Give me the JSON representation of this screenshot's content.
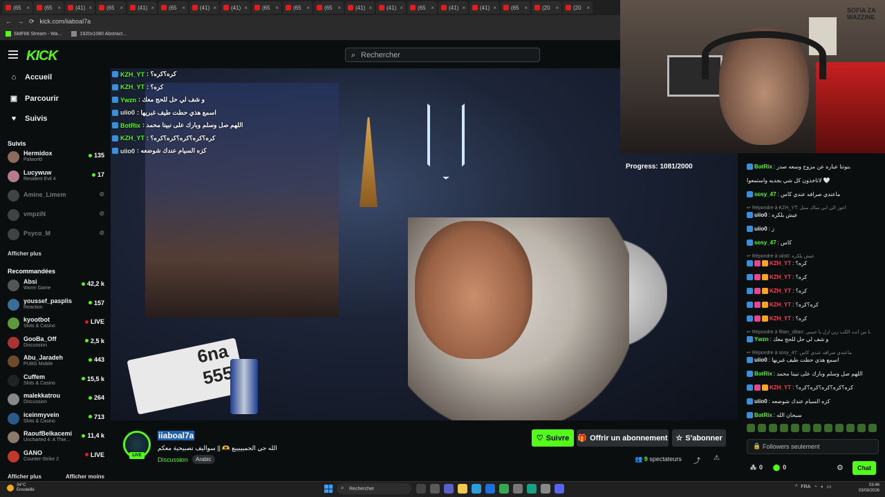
{
  "browser": {
    "tabs": [
      {
        "label": "(65"
      },
      {
        "label": "(65"
      },
      {
        "label": "(41)"
      },
      {
        "label": "(65"
      },
      {
        "label": "(41)"
      },
      {
        "label": "(65"
      },
      {
        "label": "(41)"
      },
      {
        "label": "(41)"
      },
      {
        "label": "(65"
      },
      {
        "label": "(65"
      },
      {
        "label": "(65"
      },
      {
        "label": "(41)"
      },
      {
        "label": "(41)"
      },
      {
        "label": "(65"
      },
      {
        "label": "(41)"
      },
      {
        "label": "(41)"
      },
      {
        "label": "(65"
      },
      {
        "label": "(20"
      },
      {
        "label": "(20"
      }
    ],
    "url": "kick.com/iiaboal7a",
    "bookmarks": [
      "SMF86 Stream - Wa...",
      "1920x1080 Abstract..."
    ]
  },
  "header": {
    "logo": "KICK",
    "search_placeholder": "Rechercher"
  },
  "sidebar": {
    "nav": [
      {
        "label": "Accueil",
        "icon": "home-icon"
      },
      {
        "label": "Parcourir",
        "icon": "browse-icon"
      },
      {
        "label": "Suivis",
        "icon": "heart-icon"
      }
    ],
    "following_title": "Suivis",
    "following": [
      {
        "name": "Hermidox",
        "game": "Palworld",
        "viewers": "135",
        "live": true
      },
      {
        "name": "Lucywuw",
        "game": "Resident Evil 4",
        "viewers": "17",
        "live": true
      },
      {
        "name": "Amine_Limem",
        "game": "",
        "viewers": "",
        "live": false
      },
      {
        "name": "vmpziN",
        "game": "",
        "viewers": "",
        "live": false
      },
      {
        "name": "Psyco_M",
        "game": "",
        "viewers": "",
        "live": false
      }
    ],
    "show_more": "Afficher plus",
    "recommended_title": "Recommandées",
    "recommended": [
      {
        "name": "Absi",
        "game": "Worm Game",
        "viewers": "42,2 k"
      },
      {
        "name": "youssef_pasplis",
        "game": "Reaction",
        "viewers": "157"
      },
      {
        "name": "kyootbot",
        "game": "Slots & Casino",
        "viewers": "LIVE"
      },
      {
        "name": "GooBa_Off",
        "game": "Discussion",
        "viewers": "2,5 k"
      },
      {
        "name": "Abu_Jaradeh",
        "game": "PUBG Mobile",
        "viewers": "443"
      },
      {
        "name": "Cuffem",
        "game": "Slots & Casino",
        "viewers": "15,5 k"
      },
      {
        "name": "malekkatrou",
        "game": "Discussion",
        "viewers": "264"
      },
      {
        "name": "iceinmyvein",
        "game": "Slots & Casino",
        "viewers": "713"
      },
      {
        "name": "RaoufBelkacemi",
        "game": "Uncharted 4: A Thie...",
        "viewers": "11,4 k"
      },
      {
        "name": "GANO",
        "game": "Counter-Strike 2",
        "viewers": "LIVE"
      }
    ],
    "show_more_bottom": "Afficher plus",
    "show_less": "Afficher moins"
  },
  "overlay_chat": [
    {
      "user": "KZH_YT",
      "color": "#53fc18",
      "msg": ": كره؟كره؟"
    },
    {
      "user": "KZH_YT",
      "color": "#53fc18",
      "msg": ": كره؟"
    },
    {
      "user": "Ywzn",
      "color": "#53fc18",
      "msg": ": و شف لي حل للحج معك"
    },
    {
      "user": "uiio0",
      "color": "#e8e8e8",
      "msg": ": اسمع هذي حطت طيف غبريها"
    },
    {
      "user": "BotRix",
      "color": "#53fc18",
      "msg": ": اللهم صل وسلم وبارك على نبينا محمد"
    },
    {
      "user": "KZH_YT",
      "color": "#53fc18",
      "msg": ": كره؟كره؟كره؟كره؟كره؟"
    },
    {
      "user": "uiio0",
      "color": "#e8e8e8",
      "msg": ": كزه السيام عندك شوضعه"
    }
  ],
  "webcam": {
    "progress": "Progress: 1081/2000",
    "wall_text": "SOFIA ZA WAZZINE"
  },
  "chat": {
    "messages": [
      {
        "type": "msg",
        "user": "BotRix",
        "color": "#53fc18",
        "text": ": بنوتنا عباره عن مزوح وسعه صدر"
      },
      {
        "type": "text",
        "text": "لاتاخذون كل شي بجديه واستمعوا 🤍"
      },
      {
        "type": "msg",
        "user": "sosy_47",
        "color": "#53fc18",
        "text": ": ماعندي صرافه عندي كاس"
      },
      {
        "type": "reply",
        "text": "Répondre à KZH_YT: اعور الي ابي ساك ستل"
      },
      {
        "type": "msg",
        "user": "uiio0",
        "color": "#e8e8e8",
        "text": ": عيش يلكره"
      },
      {
        "type": "msg",
        "user": "uiio0",
        "color": "#e8e8e8",
        "text": ": ز"
      },
      {
        "type": "msg",
        "user": "sosy_47",
        "color": "#53fc18",
        "text": ": كاس"
      },
      {
        "type": "reply",
        "text": "Répondre à uiio0: عيش يلكره"
      },
      {
        "type": "msg",
        "user": "KZH_YT",
        "color": "#ff3b5c",
        "text": ": كره؟"
      },
      {
        "type": "msg",
        "user": "KZH_YT",
        "color": "#ff3b5c",
        "text": ": كره؟"
      },
      {
        "type": "msg",
        "user": "KZH_YT",
        "color": "#ff3b5c",
        "text": ": كره؟"
      },
      {
        "type": "msg",
        "user": "KZH_YT",
        "color": "#ff3b5c",
        "text": ": كره؟كره؟"
      },
      {
        "type": "msg",
        "user": "KZH_YT",
        "color": "#ff3b5c",
        "text": ": كره؟"
      },
      {
        "type": "reply",
        "text": "Répondre à flitan_slitan: يا من انت الكب زين ازل يا حبيبي"
      },
      {
        "type": "msg",
        "user": "Ywzn",
        "color": "#53fc18",
        "text": ": و شف لي حل للحج معك"
      },
      {
        "type": "reply",
        "text": "Répondre à sosy_47: ماعندي صرافه عندي كاس"
      },
      {
        "type": "msg",
        "user": "uiio0",
        "color": "#e8e8e8",
        "text": ": اسمع هذي حطت طيف غبريها"
      },
      {
        "type": "msg",
        "user": "BotRix",
        "color": "#53fc18",
        "text": ": اللهم صل وسلم وبارك على نبينا محمد"
      },
      {
        "type": "msg",
        "user": "KZH_YT",
        "color": "#ff3b5c",
        "text": ": كره؟كره؟كره؟كره؟كره؟"
      },
      {
        "type": "msg",
        "user": "uiio0",
        "color": "#e8e8e8",
        "text": ": كزه السيام عندك شوضعه"
      },
      {
        "type": "msg",
        "user": "BotRix",
        "color": "#53fc18",
        "text": ": سبحان الله"
      }
    ],
    "input_placeholder": "Followers seulement",
    "points": "0",
    "kicks": "0",
    "chat_button": "Chat"
  },
  "channel": {
    "name": "iiaboal7a",
    "live_label": "LIVE",
    "title": "الله حي الجميييييع 🫶 || سواليف تصبيحية معكم",
    "category": "Discussion",
    "tag": "Arabic",
    "follow": "Suivre",
    "gift": "Offrir un abonnement",
    "subscribe": "S'abonner",
    "viewers_count": "9",
    "viewers_label": "spectateurs"
  },
  "taskbar": {
    "weather_temp": "34°C",
    "weather_desc": "Ensoleillé",
    "search": "Rechercher",
    "lang": "FRA",
    "time": "03:46",
    "date": "03/08/2026"
  }
}
